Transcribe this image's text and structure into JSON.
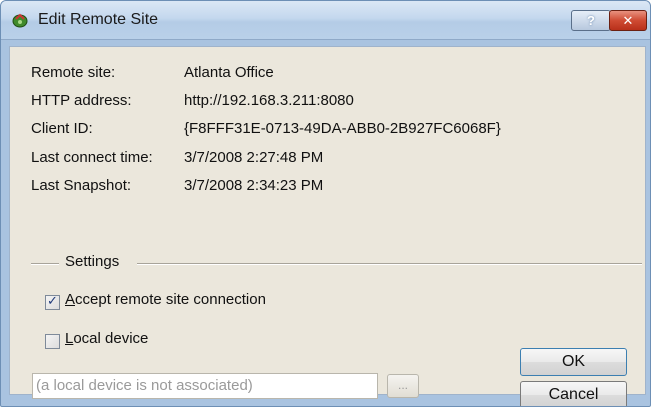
{
  "window": {
    "title": "Edit Remote Site",
    "help_glyph": "?",
    "close_glyph": "✕"
  },
  "info": [
    {
      "label": "Remote site:",
      "value": "Atlanta Office"
    },
    {
      "label": "HTTP address:",
      "value": "http://192.168.3.211:8080"
    },
    {
      "label": "Client ID:",
      "value": "{F8FFF31E-0713-49DA-ABB0-2B927FC6068F}"
    },
    {
      "label": "Last connect time:",
      "value": "3/7/2008 2:27:48 PM"
    },
    {
      "label": "Last Snapshot:",
      "value": "3/7/2008 2:34:23 PM"
    }
  ],
  "settings": {
    "group_title": "Settings",
    "accept_connection": {
      "label_access_key": "A",
      "label_rest": "ccept remote site connection",
      "checked": true
    },
    "local_device": {
      "label_access_key": "L",
      "label_rest": "ocal device",
      "checked": false
    },
    "device_field_placeholder": "(a local device is not associated)",
    "browse_label": "..."
  },
  "buttons": {
    "ok": "OK",
    "cancel": "Cancel"
  },
  "icons": {
    "app": "remote-site-icon",
    "help": "help-icon",
    "close": "close-icon",
    "check": "checkmark-icon"
  }
}
